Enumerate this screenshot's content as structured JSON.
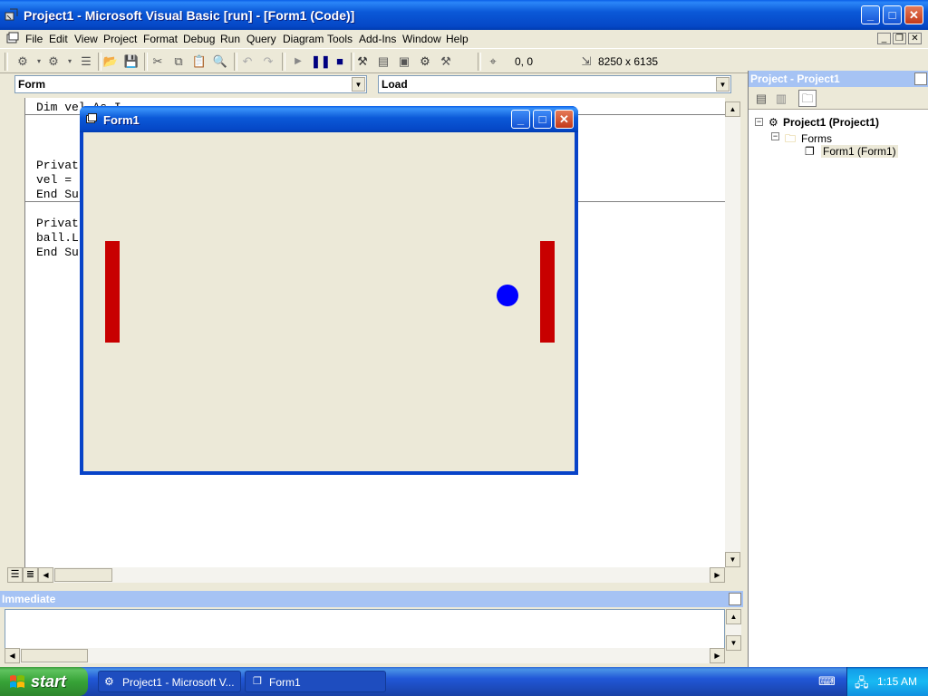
{
  "window": {
    "title": "Project1 - Microsoft Visual Basic [run] - [Form1 (Code)]",
    "minimize": "_",
    "maximize": "□",
    "close": "✕"
  },
  "menu": [
    "File",
    "Edit",
    "View",
    "Project",
    "Format",
    "Debug",
    "Run",
    "Query",
    "Diagram",
    "Tools",
    "Add-Ins",
    "Window",
    "Help"
  ],
  "toolbar": {
    "position": "0, 0",
    "size": "8250 x 6135"
  },
  "code_window": {
    "object_combo": "Form",
    "procedure_combo": "Load",
    "lines": [
      "Dim vel As I",
      "",
      "",
      "Privat",
      "vel =",
      "End Su",
      "",
      "Privat",
      "ball.L",
      "End Su"
    ]
  },
  "form1": {
    "title": "Form1",
    "colors": {
      "paddle": "#c80000",
      "ball": "#0000ff",
      "background": "#ece9d8"
    }
  },
  "project_explorer": {
    "title": "Project - Project1",
    "root": "Project1 (Project1)",
    "folder": "Forms",
    "item": "Form1 (Form1)"
  },
  "immediate": {
    "title": "Immediate"
  },
  "taskbar": {
    "start": "start",
    "tasks": [
      "Project1 - Microsoft V...",
      "Form1"
    ],
    "clock": "1:15 AM"
  }
}
